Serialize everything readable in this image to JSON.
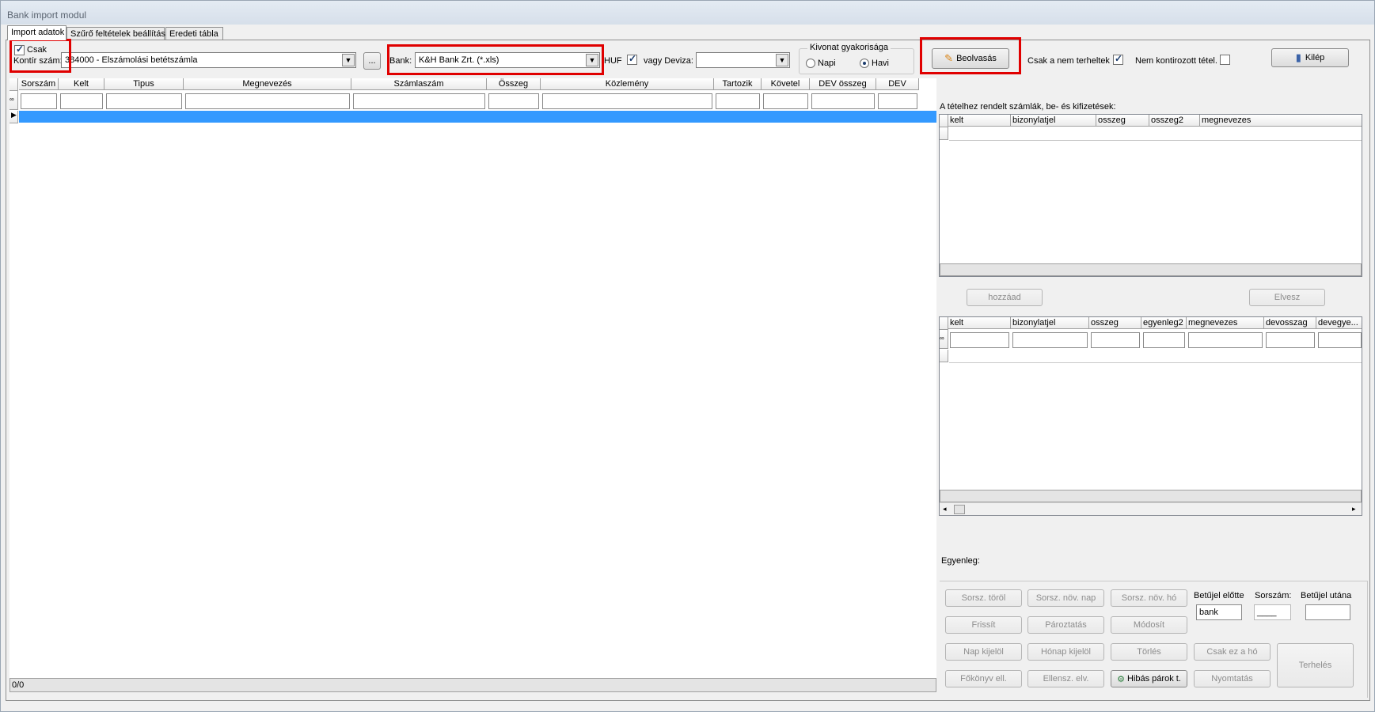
{
  "window": {
    "title": "Bank import modul"
  },
  "tabs": [
    "Import adatok",
    "Szűrő feltételek beállítása",
    "Eredeti tábla"
  ],
  "top": {
    "csak_label": "Csak",
    "kontir_label": "Kontír szám:",
    "kontir_value": "384000 - Elszámolási betétszámla",
    "browse_label": "...",
    "bank_label": "Bank:",
    "bank_value": "K&H Bank Zrt. (*.xls)",
    "huf_label": "HUF",
    "deviza_label": "vagy Deviza:",
    "deviza_value": "",
    "kivonat_title": "Kivonat gyakorisága",
    "napi_label": "Napi",
    "havi_label": "Havi",
    "beolvasas_label": "Beolvasás",
    "csak_nem_terheltek_label": "Csak a nem terheltek",
    "nem_kontirozott_label": "Nem kontirozott tétel.",
    "kilep_label": "Kilép"
  },
  "main_grid": {
    "columns": [
      "Sorszám",
      "Kelt",
      "Tipus",
      "Megnevezés",
      "Számlaszám",
      "Összeg",
      "Közlemény",
      "Tartozik",
      "Követel",
      "DEV összeg",
      "DEV"
    ],
    "status": "0/0"
  },
  "right": {
    "assigned_label": "A tételhez rendelt számlák, be- és kifizetések:",
    "grid1_columns": [
      "kelt",
      "bizonylatjel",
      "osszeg",
      "osszeg2",
      "megnevezes"
    ],
    "hozzaad_label": "hozzáad",
    "elvesz_label": "Elvesz",
    "grid2_columns": [
      "kelt",
      "bizonylatjel",
      "osszeg",
      "egyenleg2",
      "megnevezes",
      "devosszag",
      "devegye..."
    ],
    "egyenleg_label": "Egyenleg:",
    "betujel_elotte_label": "Betűjel előtte",
    "sorszam_label": "Sorszám:",
    "betujel_utana_label": "Betűjel utána",
    "betujel_elotte_value": "bank",
    "sorszam_value": "____",
    "buttons": {
      "sorsz_torol": "Sorsz. töröl",
      "sorsz_nov_nap": "Sorsz. növ. nap",
      "sorsz_nov_ho": "Sorsz. növ. hó",
      "frissit": "Frissít",
      "paroztatas": "Pároztatás",
      "modosit": "Módosít",
      "nap_kijelol": "Nap kijelöl",
      "honap_kijelol": "Hónap kijelöl",
      "torles": "Törlés",
      "csak_ez_a_ho": "Csak ez a hó",
      "terheles": "Terhelés",
      "fokonyv_ell": "Főkönyv ell.",
      "ellensz_elv": "Ellensz. elv.",
      "hibas_parok": "Hibás párok t.",
      "nyomtatas": "Nyomtatás"
    }
  },
  "colors": {
    "selection": "#3399ff",
    "highlight": "#e00000"
  }
}
